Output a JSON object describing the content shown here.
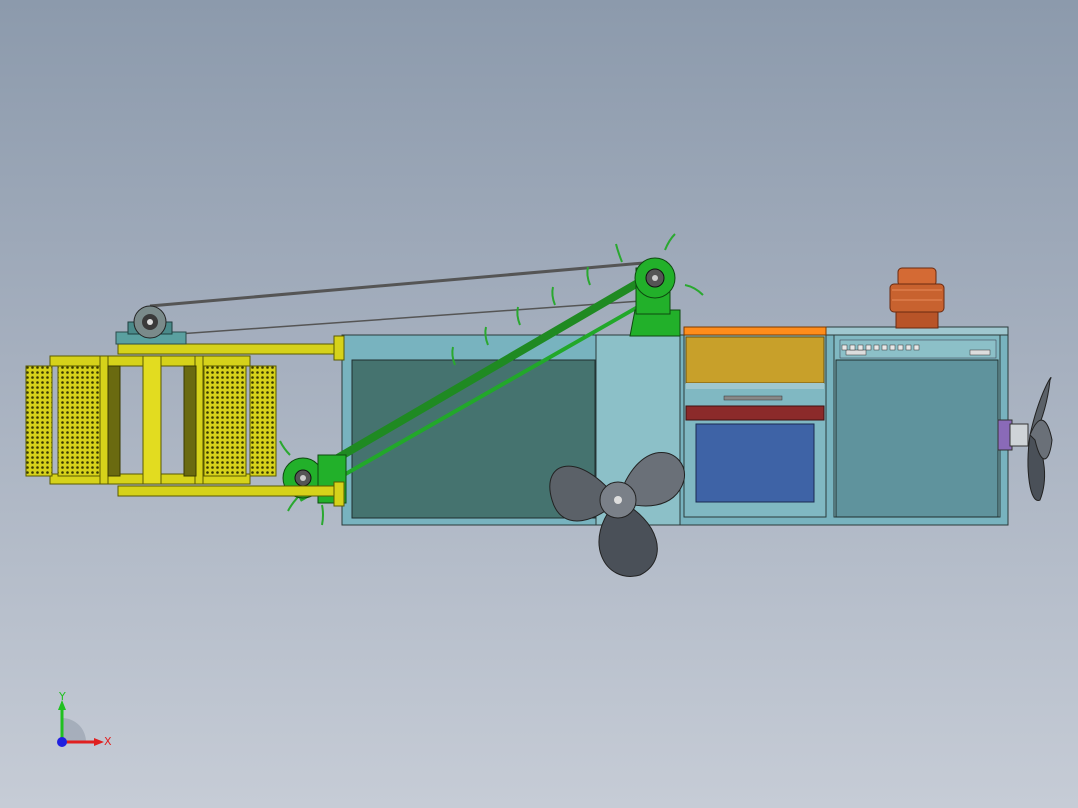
{
  "scene": {
    "name": "cad-assembly-view",
    "colors": {
      "background_top": "#8c9aac",
      "background_bottom": "#c6ccd6",
      "hull": "#6fa8b4",
      "hull_dark": "#45736f",
      "frame_yellow": "#d6d21a",
      "conveyor_green": "#22a82a",
      "fan_blade": "#5b6168",
      "battery_orange": "#c8a02a",
      "box_blue": "#3e63a6",
      "motor_copper": "#c8622f",
      "divider_red": "#8b2a2a",
      "top_strip": "#ff8c1a"
    }
  },
  "triad": {
    "x_label": "X",
    "y_label": "Y",
    "x_color": "#e02020",
    "y_color": "#20c020",
    "z_color": "#2020e0"
  }
}
